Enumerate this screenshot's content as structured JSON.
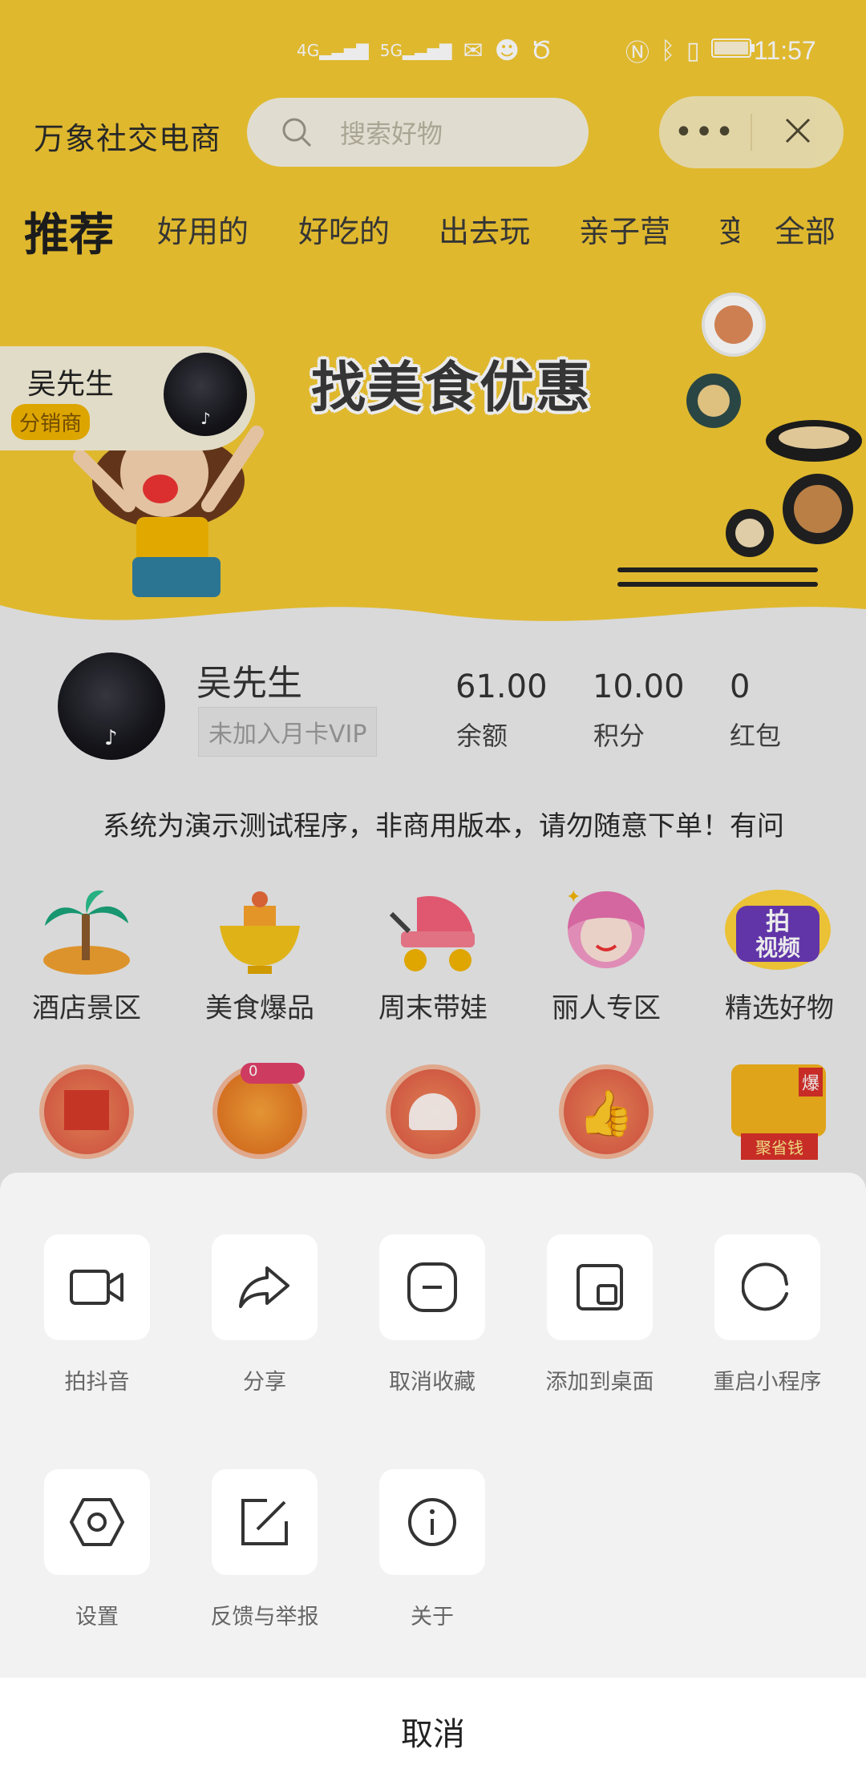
{
  "status_bar": {
    "time": "11:57",
    "signal_1": "4G",
    "signal_2": "5G"
  },
  "header": {
    "app_title": "万象社交电商",
    "search_placeholder": "搜索好物"
  },
  "tabs": [
    {
      "label": "推荐",
      "active": true
    },
    {
      "label": "好用的"
    },
    {
      "label": "好吃的"
    },
    {
      "label": "出去玩"
    },
    {
      "label": "亲子营"
    },
    {
      "label": "变"
    },
    {
      "label": "全部"
    }
  ],
  "banner": {
    "title": "找美食优惠",
    "distributor_name": "吴先生",
    "distributor_badge": "分销商"
  },
  "profile": {
    "name": "吴先生",
    "vip_status": "未加入月卡VIP",
    "stats": [
      {
        "value": "61.00",
        "label": "余额"
      },
      {
        "value": "10.00",
        "label": "积分"
      },
      {
        "value": "0",
        "label": "红包"
      }
    ]
  },
  "notice": "系统为演示测试程序，非商用版本，请勿随意下单！有问",
  "categories": [
    {
      "label": "酒店景区",
      "icon": "island-icon"
    },
    {
      "label": "美食爆品",
      "icon": "food-bowl-icon"
    },
    {
      "label": "周末带娃",
      "icon": "stroller-icon"
    },
    {
      "label": "丽人专区",
      "icon": "beauty-icon"
    },
    {
      "label": "精选好物",
      "icon": "video-badge-icon"
    }
  ],
  "second_row": {
    "badge_count": "0",
    "promo_text": "聚省钱",
    "hot_text": "爆"
  },
  "action_sheet": {
    "row1": [
      {
        "label": "拍抖音",
        "icon": "video-camera-icon"
      },
      {
        "label": "分享",
        "icon": "share-icon"
      },
      {
        "label": "取消收藏",
        "icon": "unfavorite-icon"
      },
      {
        "label": "添加到桌面",
        "icon": "add-to-desktop-icon"
      },
      {
        "label": "重启小程序",
        "icon": "restart-icon"
      }
    ],
    "row2": [
      {
        "label": "设置",
        "icon": "settings-icon"
      },
      {
        "label": "反馈与举报",
        "icon": "feedback-icon"
      },
      {
        "label": "关于",
        "icon": "info-icon"
      }
    ],
    "cancel": "取消"
  }
}
